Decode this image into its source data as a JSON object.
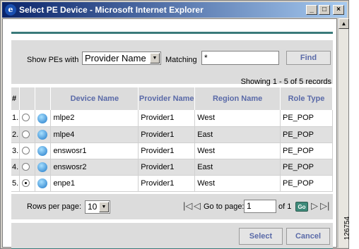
{
  "window": {
    "title": "Select PE Device - Microsoft Internet Explorer",
    "minimize_glyph": "_",
    "maximize_glyph": "□",
    "close_glyph": "×"
  },
  "filter": {
    "show_label": "Show PEs with",
    "attribute_value": "Provider Name",
    "matching_label": "Matching",
    "match_value": "*",
    "find_label": "Find"
  },
  "showing_text": "Showing 1 - 5 of 5 records",
  "table": {
    "columns": [
      "#",
      "Device Name",
      "Provider Name",
      "Region Name",
      "Role Type"
    ],
    "rows": [
      {
        "num": "1.",
        "selected": false,
        "device": "mlpe2",
        "provider": "Provider1",
        "region": "West",
        "role": "PE_POP"
      },
      {
        "num": "2.",
        "selected": false,
        "device": "mlpe4",
        "provider": "Provider1",
        "region": "East",
        "role": "PE_POP"
      },
      {
        "num": "3.",
        "selected": false,
        "device": "enswosr1",
        "provider": "Provider1",
        "region": "West",
        "role": "PE_POP"
      },
      {
        "num": "4.",
        "selected": false,
        "device": "enswosr2",
        "provider": "Provider1",
        "region": "East",
        "role": "PE_POP"
      },
      {
        "num": "5.",
        "selected": true,
        "device": "enpe1",
        "provider": "Provider1",
        "region": "West",
        "role": "PE_POP"
      }
    ]
  },
  "pager": {
    "rows_label": "Rows per page:",
    "rows_value": "10",
    "goto_label": "Go to page:",
    "page_value": "1",
    "of_label": "of 1",
    "go_label": "Go"
  },
  "actions": {
    "select_label": "Select",
    "cancel_label": "Cancel"
  },
  "figure_code": "126754",
  "colors": {
    "header_text": "#5a6aa8",
    "panel_rule": "#3a7a7a",
    "title_bar": "#0a246a"
  }
}
